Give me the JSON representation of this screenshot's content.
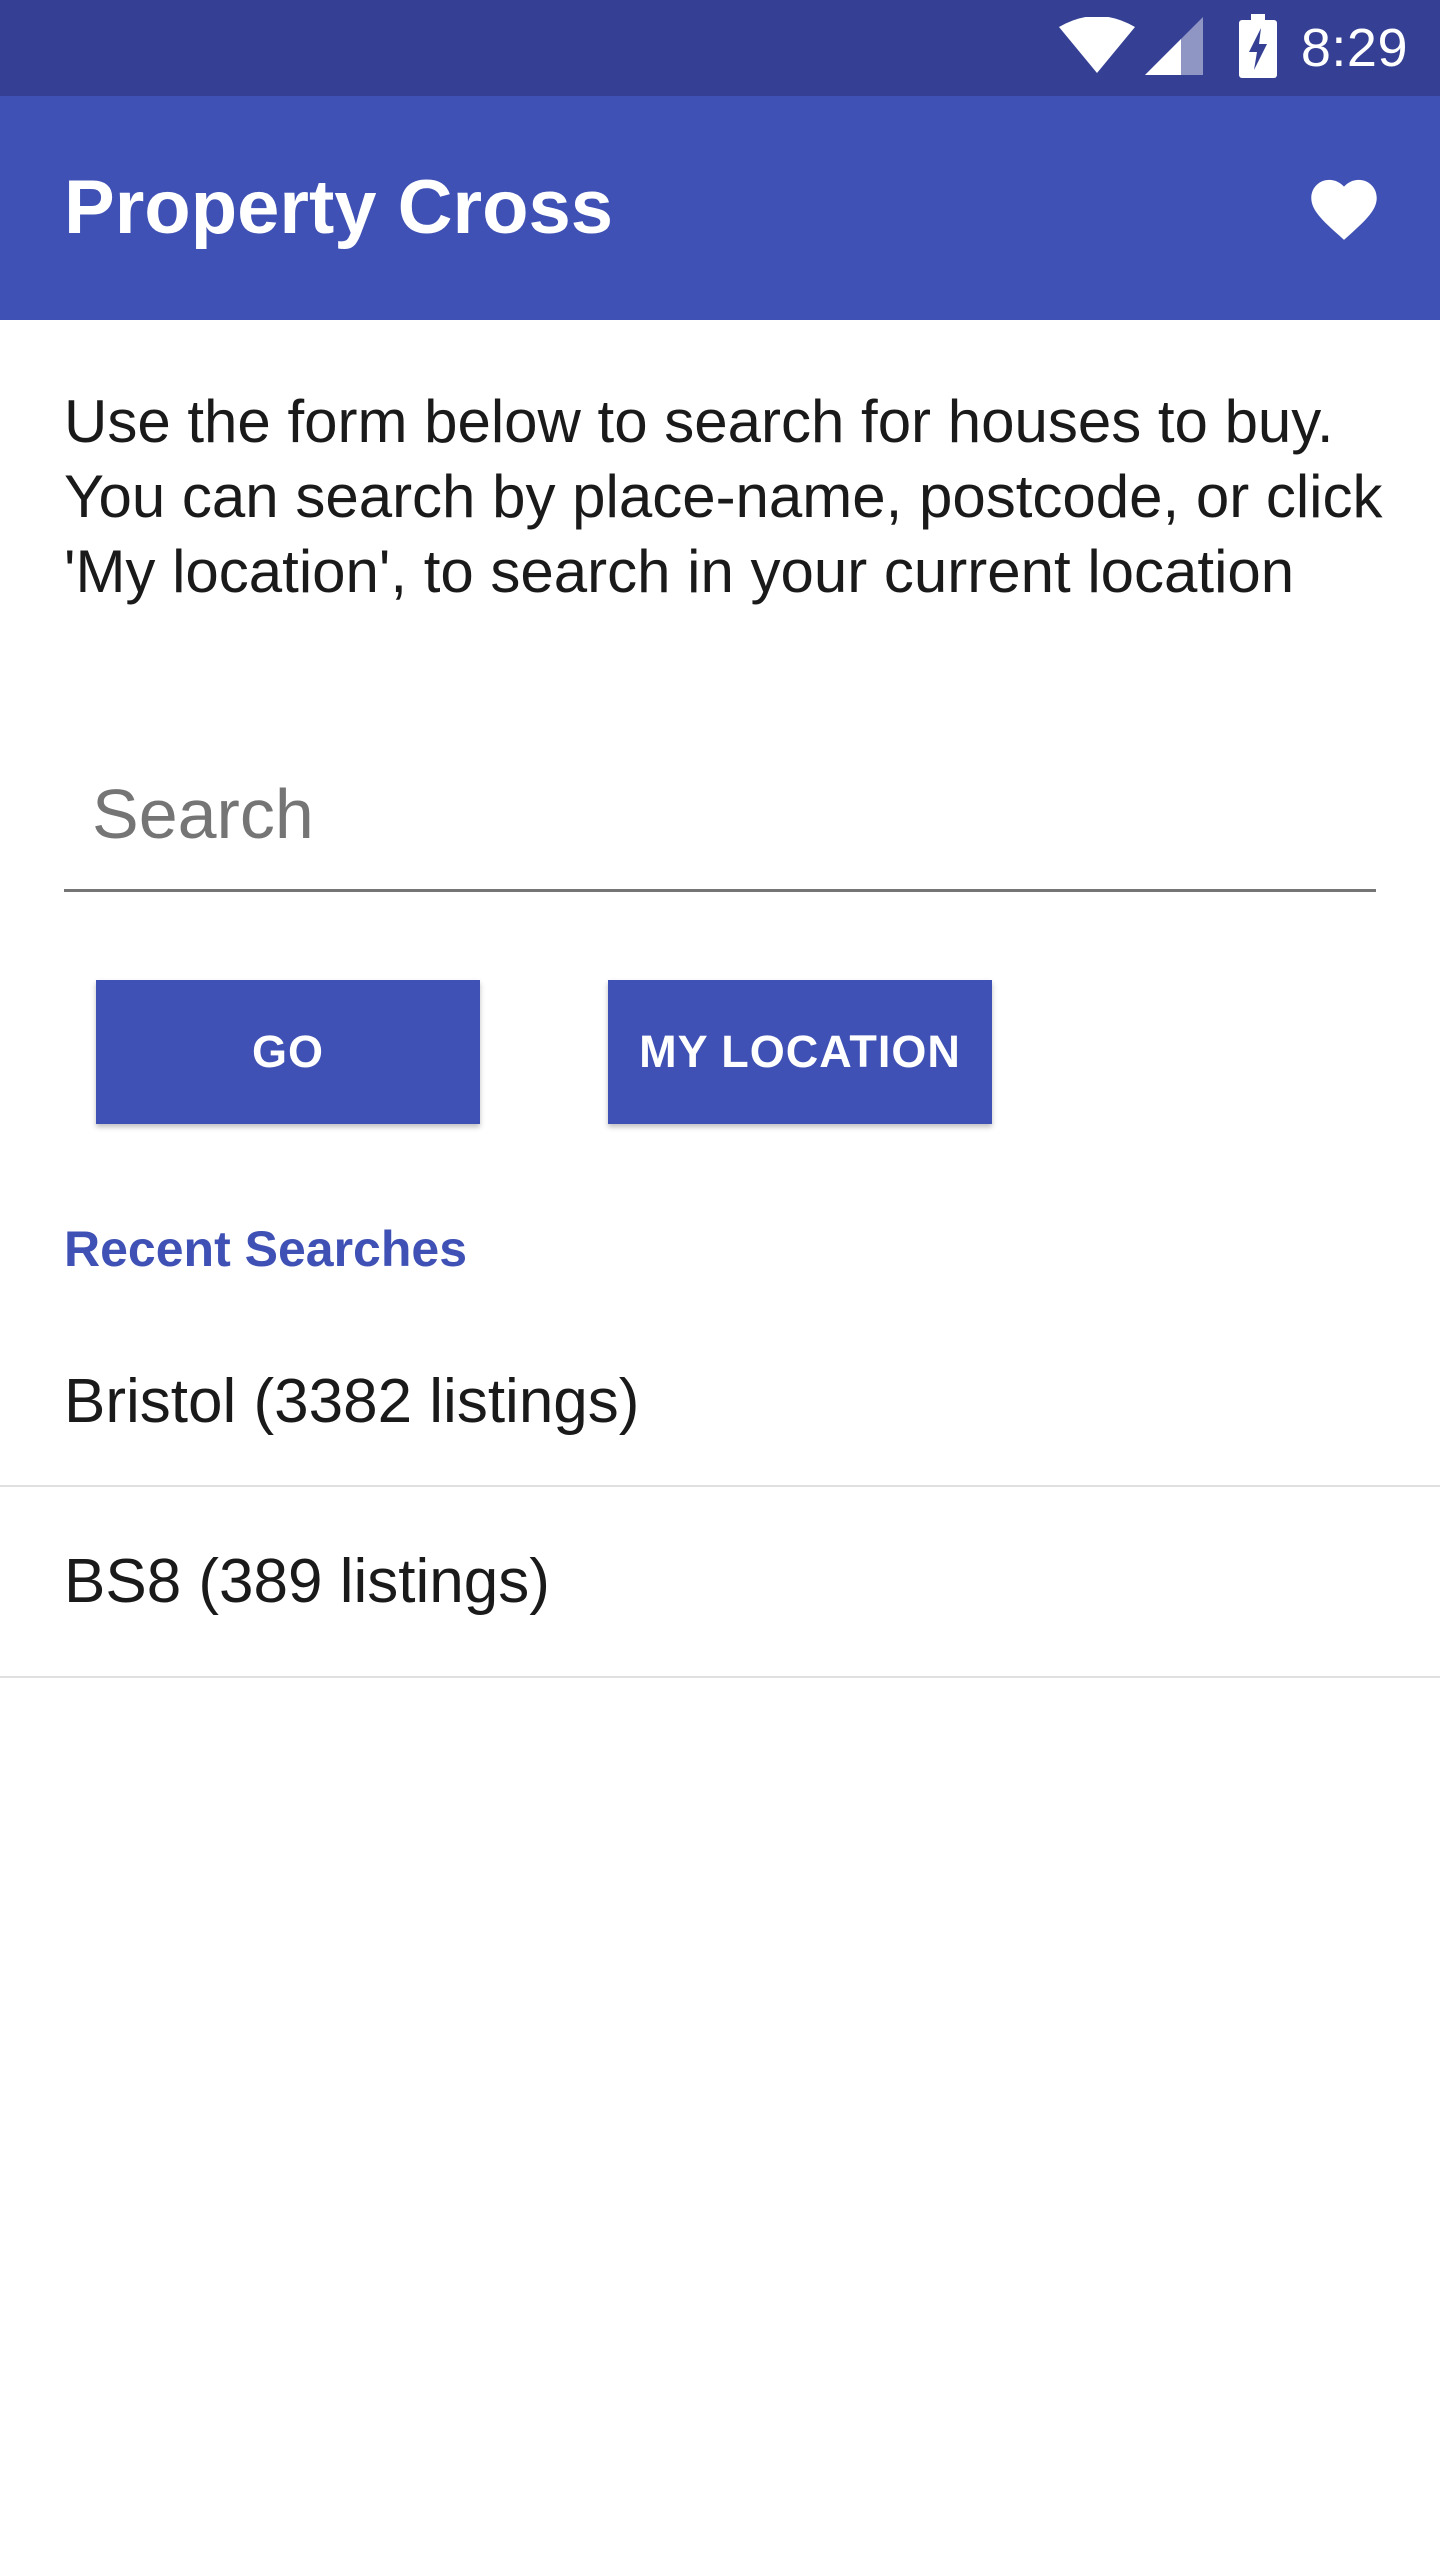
{
  "status_bar": {
    "time": "8:29",
    "icons": [
      "wifi-icon",
      "signal-icon",
      "battery-charging-icon"
    ]
  },
  "app_bar": {
    "title": "Property Cross",
    "favourites_icon": "heart-icon"
  },
  "intro_text": "Use the form below to search for houses to buy. You can search by place-name, postcode, or click 'My location', to search in your current location",
  "search": {
    "placeholder": "Search",
    "value": ""
  },
  "buttons": {
    "go_label": "GO",
    "my_location_label": "MY LOCATION"
  },
  "recent_searches": {
    "header": "Recent Searches",
    "items": [
      {
        "label": "Bristol (3382 listings)"
      },
      {
        "label": "BS8 (389 listings)"
      }
    ]
  },
  "colors": {
    "primary": "#3f51b5",
    "primary_dark": "#354094",
    "divider": "#e0e0e0"
  }
}
